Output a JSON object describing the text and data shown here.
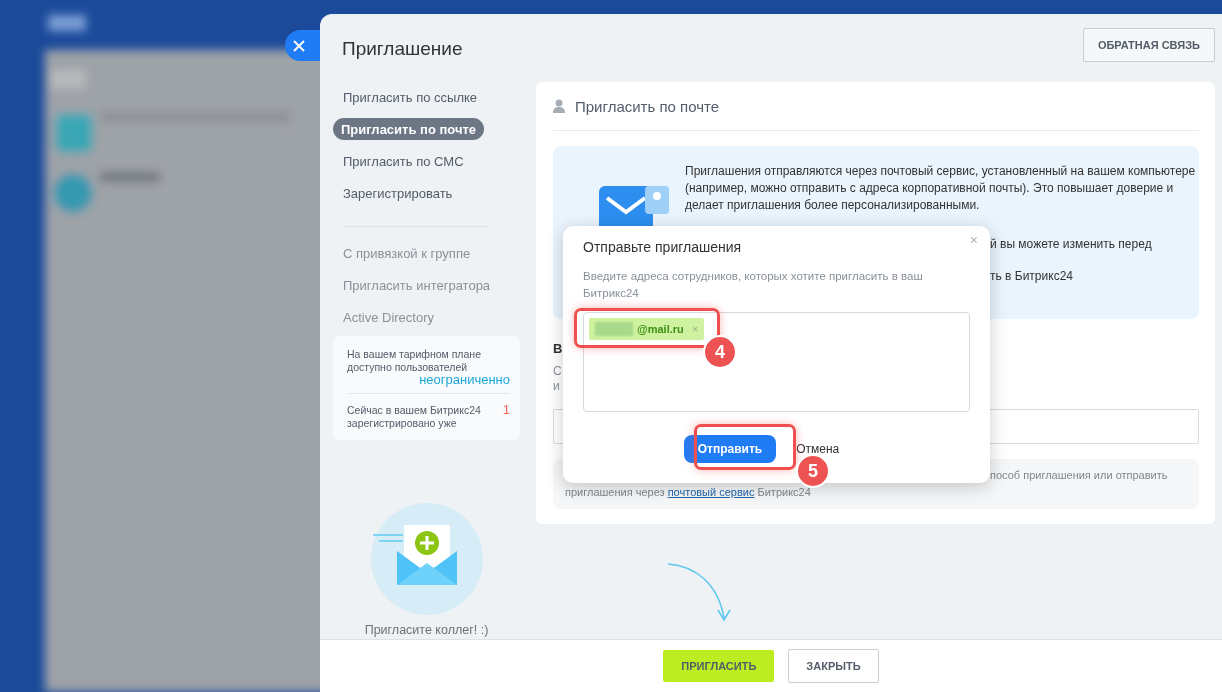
{
  "window": {
    "title": "Приглашение",
    "feedback_button": "ОБРАТНАЯ СВЯЗЬ"
  },
  "nav_primary": [
    {
      "label": "Пригласить по ссылке",
      "selected": false
    },
    {
      "label": "Пригласить по почте",
      "selected": true
    },
    {
      "label": "Пригласить по СМС",
      "selected": false
    },
    {
      "label": "Зарегистрировать",
      "selected": false
    }
  ],
  "nav_secondary": [
    {
      "label": "С привязкой к группе"
    },
    {
      "label": "Пригласить интегратора"
    },
    {
      "label": "Active Directory"
    }
  ],
  "plan_info": [
    {
      "label": "На вашем тарифном плане доступно пользователей",
      "value": "неограниченно",
      "color": "#1ea7d9"
    },
    {
      "label": "Сейчас в вашем Битрикс24 зарегистрировано уже",
      "value": "1",
      "color": "#f0635b"
    }
  ],
  "illustration_caption": "Пригласите коллег! :)",
  "card": {
    "title": "Пригласить по почте",
    "info_text": "Приглашения отправляются через почтовый сервис, установленный на вашем компьютере (например, можно отправить с адреса корпоративной почты). Это повышает доверие и делает приглашения более персонализированными.",
    "info_fragments": [
      "й вы можете изменить перед",
      "ть в Битрикс24"
    ],
    "section_fragments": [
      "В",
      "С",
      "и"
    ],
    "note_fragment": "пособ приглашения или отправить",
    "note_text_before": "приглашения через ",
    "note_link": "почтовый сервис",
    "note_text_after": " Битрикс24"
  },
  "dialog": {
    "title": "Отправьте приглашения",
    "description": "Введите адреса сотрудников, которых хотите пригласить в ваш Битрикс24",
    "recipients": [
      {
        "text": "@mail.ru",
        "remove": "×"
      }
    ],
    "close": "×",
    "submit": "Отправить",
    "cancel": "Отмена"
  },
  "annotations": [
    "4",
    "5"
  ],
  "footer": {
    "invite_button": "ПРИГЛАСИТЬ",
    "close_button": "ЗАКРЫТЬ"
  }
}
